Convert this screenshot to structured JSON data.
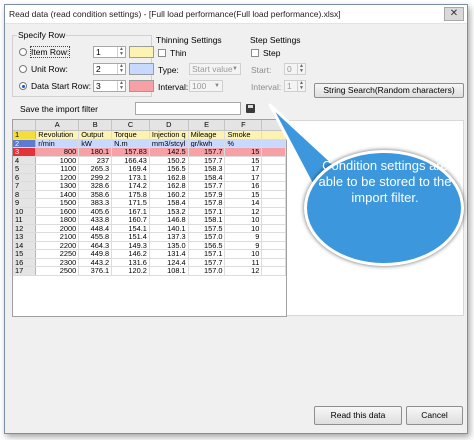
{
  "window": {
    "title": "Read data (read condition settings) - [Full load performance(Full load performance).xlsx]",
    "close_glyph": "✕"
  },
  "specify_row": {
    "label": "Specify Row",
    "item_row": {
      "label": "Item Row:",
      "value": "1",
      "color": "#fcf3b2",
      "selected": false
    },
    "unit_row": {
      "label": "Unit Row:",
      "value": "2",
      "color": "#c9d8ff",
      "selected": false
    },
    "data_start_row": {
      "label": "Data Start Row:",
      "value": "3",
      "color": "#f7a1a7",
      "selected": true
    }
  },
  "thinning": {
    "label": "Thinning Settings",
    "thin_label": "Thin",
    "type_label": "Type:",
    "type_value": "Start value",
    "interval_label": "Interval:",
    "interval_value": "100"
  },
  "step": {
    "label": "Step Settings",
    "step_label": "Step",
    "start_label": "Start:",
    "start_value": "0",
    "interval_label": "Interval:",
    "interval_value": "1"
  },
  "string_search_label": "String Search(Random characters)",
  "save_filter": {
    "label": "Save the import filter",
    "value": ""
  },
  "sheet": {
    "columns": [
      "A",
      "B",
      "C",
      "D",
      "E",
      "F"
    ],
    "rows": [
      {
        "n": "1",
        "kind": "item",
        "cells": [
          "Revolution",
          "Output",
          "Torque",
          "Injection q",
          "Mileage",
          "Smoke"
        ]
      },
      {
        "n": "2",
        "kind": "unit",
        "cells": [
          "r/min",
          "kW",
          "N.m",
          "mm3/stcyl",
          "gr/kwh",
          "%"
        ]
      },
      {
        "n": "3",
        "kind": "start",
        "cells": [
          "800",
          "180.1",
          "157.83",
          "142.5",
          "157.7",
          "15"
        ]
      },
      {
        "n": "4",
        "kind": "",
        "cells": [
          "1000",
          "237",
          "166.43",
          "150.2",
          "157.7",
          "15"
        ]
      },
      {
        "n": "5",
        "kind": "",
        "cells": [
          "1100",
          "265.3",
          "169.4",
          "156.5",
          "158.3",
          "17"
        ]
      },
      {
        "n": "6",
        "kind": "",
        "cells": [
          "1200",
          "299.2",
          "173.1",
          "162.8",
          "158.4",
          "17"
        ]
      },
      {
        "n": "7",
        "kind": "",
        "cells": [
          "1300",
          "328.6",
          "174.2",
          "162.8",
          "157.7",
          "16"
        ]
      },
      {
        "n": "8",
        "kind": "",
        "cells": [
          "1400",
          "358.6",
          "175.8",
          "160.2",
          "157.9",
          "15"
        ]
      },
      {
        "n": "9",
        "kind": "",
        "cells": [
          "1500",
          "383.3",
          "171.5",
          "158.4",
          "157.8",
          "14"
        ]
      },
      {
        "n": "10",
        "kind": "",
        "cells": [
          "1600",
          "405.6",
          "167.1",
          "153.2",
          "157.1",
          "12"
        ]
      },
      {
        "n": "11",
        "kind": "",
        "cells": [
          "1800",
          "433.8",
          "160.7",
          "146.8",
          "158.1",
          "10"
        ]
      },
      {
        "n": "12",
        "kind": "",
        "cells": [
          "2000",
          "448.4",
          "154.1",
          "140.1",
          "157.5",
          "10"
        ]
      },
      {
        "n": "13",
        "kind": "",
        "cells": [
          "2100",
          "455.8",
          "151.4",
          "137.3",
          "157.0",
          "9"
        ]
      },
      {
        "n": "14",
        "kind": "",
        "cells": [
          "2200",
          "464.3",
          "149.3",
          "135.0",
          "156.5",
          "9"
        ]
      },
      {
        "n": "15",
        "kind": "",
        "cells": [
          "2250",
          "449.8",
          "146.2",
          "131.4",
          "157.1",
          "10"
        ]
      },
      {
        "n": "16",
        "kind": "",
        "cells": [
          "2300",
          "443.2",
          "131.6",
          "124.4",
          "157.7",
          "11"
        ]
      },
      {
        "n": "17",
        "kind": "",
        "cells": [
          "2500",
          "376.1",
          "120.2",
          "108.1",
          "157.0",
          "12"
        ]
      }
    ]
  },
  "callout": {
    "text": "Condition settings are able to be stored to the import filter."
  },
  "buttons": {
    "read": "Read this data",
    "cancel": "Cancel"
  }
}
